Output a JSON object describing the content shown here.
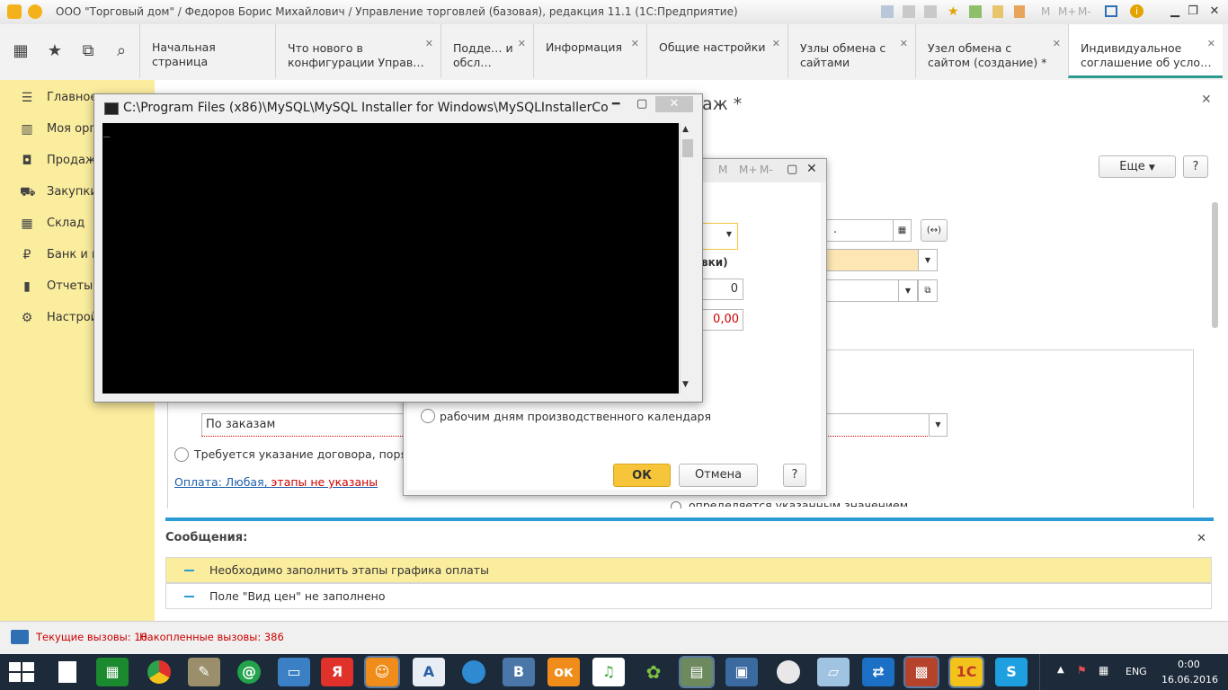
{
  "window": {
    "title": "ООО \"Торговый дом\" / Федоров Борис Михайлович / Управление торговлей (базовая), редакция 11.1  (1С:Предприятие)",
    "toolbar_m": "M",
    "toolbar_mplus": "M+",
    "toolbar_mminus": "M-"
  },
  "tabs": [
    {
      "label": "Начальная страница"
    },
    {
      "label": "Что нового в конфигурации Управ…"
    },
    {
      "label": "Подде… и обсл…"
    },
    {
      "label": "Информация"
    },
    {
      "label": "Общие настройки"
    },
    {
      "label": "Узлы обмена с сайтами"
    },
    {
      "label": "Узел обмена с сайтом (создание) *"
    },
    {
      "label": "Индивидуальное соглашение об усло…"
    }
  ],
  "sidebar": {
    "items": [
      {
        "label": "Главное",
        "icon": "menu-icon"
      },
      {
        "label": "Моя орга",
        "icon": "building-icon"
      },
      {
        "label": "Продажи",
        "icon": "bag-icon"
      },
      {
        "label": "Закупки",
        "icon": "cart-icon"
      },
      {
        "label": "Склад",
        "icon": "grid-icon"
      },
      {
        "label": "Банк и ка",
        "icon": "ruble-icon"
      },
      {
        "label": "Отчеты",
        "icon": "chart-icon"
      },
      {
        "label": "Настрой",
        "icon": "gear-icon"
      }
    ]
  },
  "form": {
    "title_tail": "аж *",
    "more_button": "Еще",
    "help_button": "?",
    "date_field_value": ".",
    "by_orders": "По заказам",
    "contract_radio": "Требуется указание договора, порядок",
    "payment_link_prefix": "Оплата: Любая, ",
    "payment_link_red": "этапы не указаны",
    "partial_text": "определяется указанным значением"
  },
  "dialog": {
    "header_snippet": "вки)",
    "num_field": "0",
    "amount_field": "0,00",
    "radio_workdays": "рабочим дням производственного календаря",
    "ok_button": "ОК",
    "cancel_button": "Отмена",
    "help_button": "?"
  },
  "console": {
    "title": "C:\\Program Files (x86)\\MySQL\\MySQL Installer for Windows\\MySQLInstallerCon…",
    "cursor": "_"
  },
  "messages": {
    "title": "Сообщения:",
    "items": [
      "Необходимо заполнить этапы графика оплаты",
      "Поле \"Вид цен\" не заполнено"
    ]
  },
  "status": {
    "current_calls": "Текущие вызовы: 10",
    "accumulated_calls": "Накопленные вызовы: 386"
  },
  "taskbar": {
    "lang": "ENG",
    "time": "0:00",
    "date": "16.06.2016",
    "apps": [
      "file-icon",
      "store-icon",
      "chrome-icon",
      "tools-icon",
      "email-icon",
      "network-icon",
      "yandex-icon",
      "uc-browser-icon",
      "word-icon",
      "globe-icon",
      "vk-icon",
      "odnoklassniki-icon",
      "music-icon",
      "icq-icon",
      "folder-icon",
      "display-icon",
      "clock-icon",
      "notes-icon",
      "teamviewer-icon",
      "firewall-icon",
      "1c-icon",
      "skype-icon"
    ]
  },
  "colors": {
    "sidebar_bg": "#fbed9e",
    "accent_blue": "#2b9bd3",
    "ok_yellow": "#f6c53a",
    "active_tab": "#2b9b8e",
    "error_red": "#cc0000"
  }
}
